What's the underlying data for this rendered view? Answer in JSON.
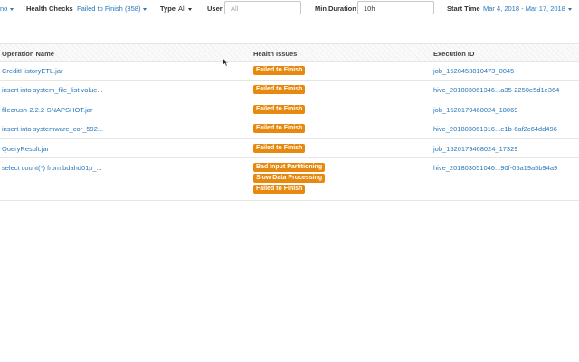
{
  "filters": {
    "first_fragment": "no",
    "health_checks_label": "Health Checks",
    "health_checks_value": "Failed to Finish (358)",
    "type_label": "Type",
    "type_value": "All",
    "user_label": "User",
    "user_placeholder": "All",
    "min_duration_label": "Min Duration",
    "min_duration_value": "10h",
    "start_time_label": "Start Time",
    "start_time_value": "Mar 4, 2018 - Mar 17, 2018"
  },
  "table": {
    "columns": [
      "Operation Name",
      "Health Issues",
      "Execution ID"
    ],
    "rows": [
      {
        "operation": "CreditHistoryETL.jar",
        "issues": [
          "Failed to Finish"
        ],
        "execution_id": "job_1520453810473_0045"
      },
      {
        "operation": "insert into system_file_list value...",
        "issues": [
          "Failed to Finish"
        ],
        "execution_id": "hive_201803061346...a35-2250e5d1e364"
      },
      {
        "operation": "filecrush-2.2.2-SNAPSHOT.jar",
        "issues": [
          "Failed to Finish"
        ],
        "execution_id": "job_1520179468024_18069"
      },
      {
        "operation": "insert into systemware_cor_592...",
        "issues": [
          "Failed to Finish"
        ],
        "execution_id": "hive_201803061316...e1b-6af2c64dd496"
      },
      {
        "operation": "QueryResult.jar",
        "issues": [
          "Failed to Finish"
        ],
        "execution_id": "job_1520179468024_17329"
      },
      {
        "operation": "select count(*) from bdahd01p_...",
        "issues": [
          "Bad Input Partitioning",
          "Slow Data Processing",
          "Failed to Finish"
        ],
        "execution_id": "hive_201803051046...90f-05a19a5b94a9"
      }
    ]
  },
  "colors": {
    "link": "#2a77b9",
    "badge": "#e8890f"
  },
  "icons": {
    "cursor": "mouse-pointer-icon"
  }
}
